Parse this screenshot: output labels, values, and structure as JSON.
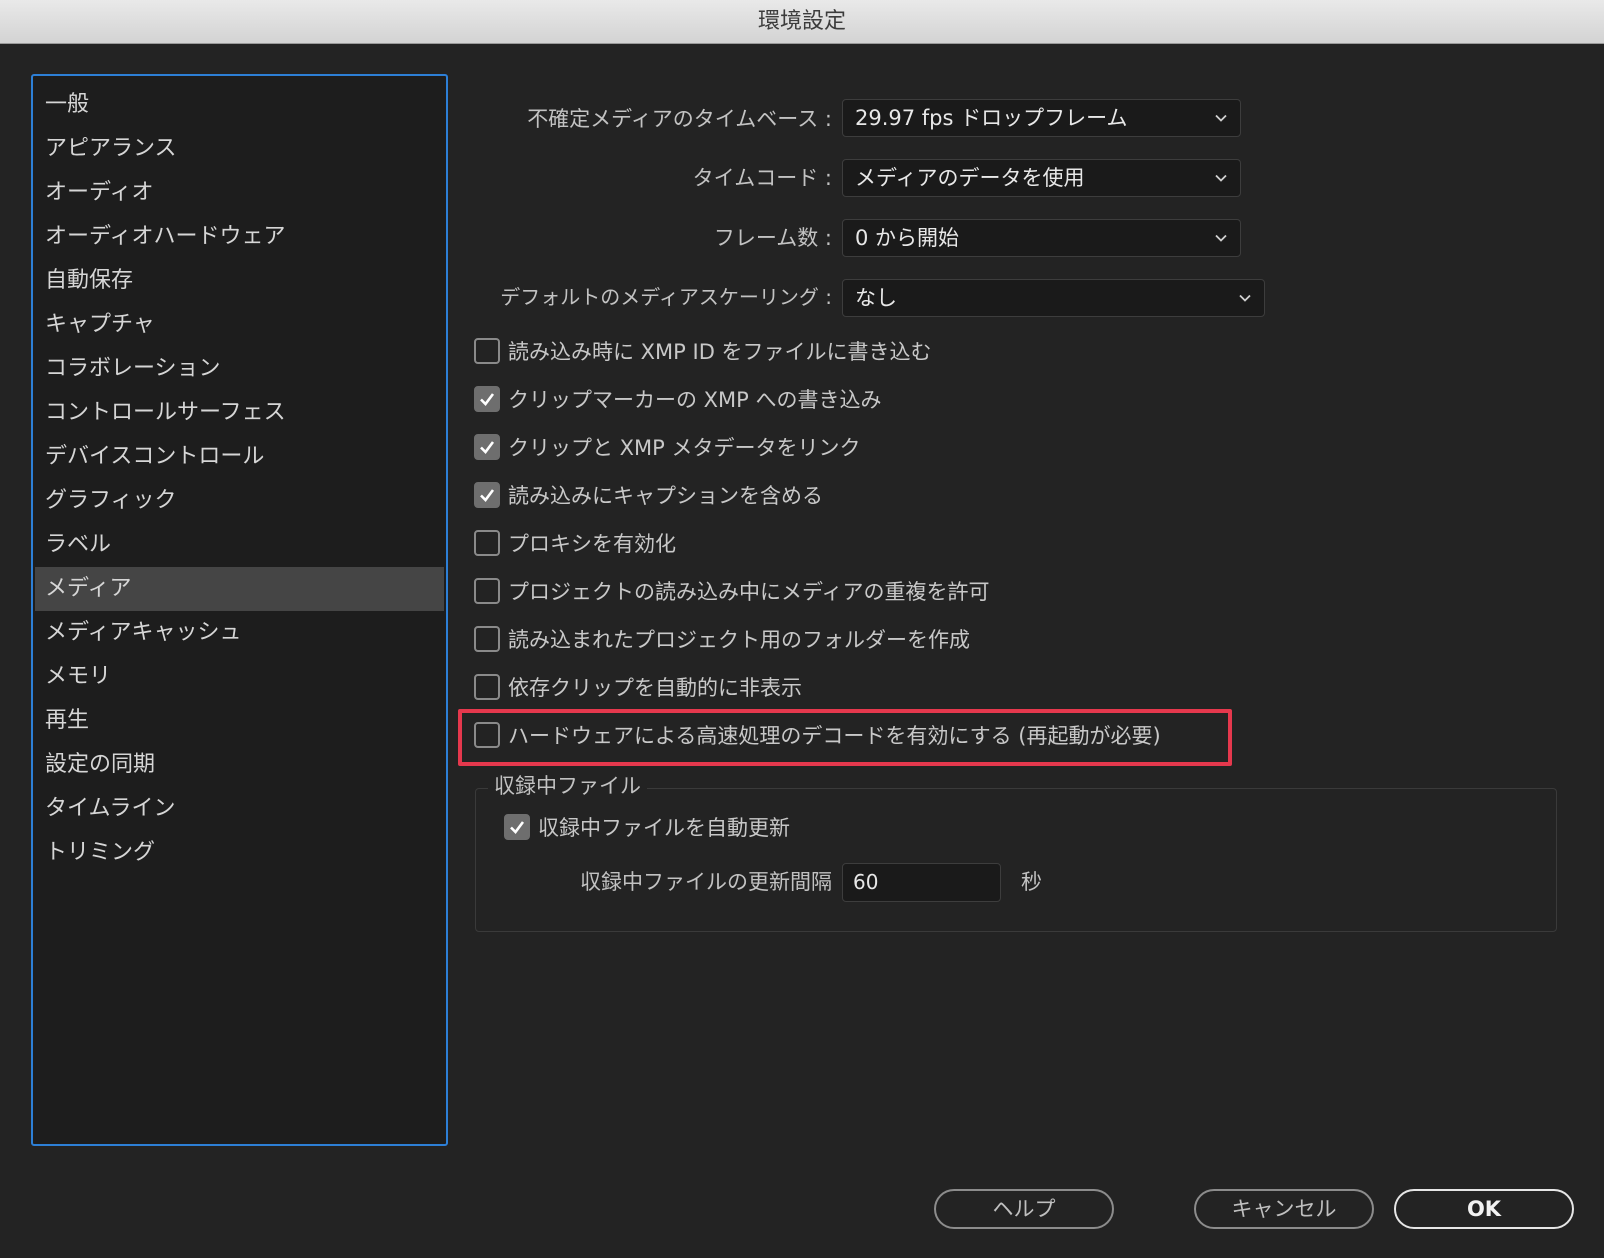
{
  "window": {
    "title": "環境設定"
  },
  "sidebar": {
    "items": [
      {
        "label": "一般"
      },
      {
        "label": "アピアランス"
      },
      {
        "label": "オーディオ"
      },
      {
        "label": "オーディオハードウェア"
      },
      {
        "label": "自動保存"
      },
      {
        "label": "キャプチャ"
      },
      {
        "label": "コラボレーション"
      },
      {
        "label": "コントロールサーフェス"
      },
      {
        "label": "デバイスコントロール"
      },
      {
        "label": "グラフィック"
      },
      {
        "label": "ラベル"
      },
      {
        "label": "メディア",
        "selected": true
      },
      {
        "label": "メディアキャッシュ"
      },
      {
        "label": "メモリ"
      },
      {
        "label": "再生"
      },
      {
        "label": "設定の同期"
      },
      {
        "label": "タイムライン"
      },
      {
        "label": "トリミング"
      }
    ]
  },
  "settings": {
    "timebase": {
      "label": "不確定メディアのタイムベース :",
      "value": "29.97 fps ドロップフレーム"
    },
    "timecode": {
      "label": "タイムコード :",
      "value": "メディアのデータを使用"
    },
    "frame_count": {
      "label": "フレーム数 :",
      "value": "0 から開始"
    },
    "scaling": {
      "label": "デフォルトのメディアスケーリング :",
      "value": "なし"
    }
  },
  "checkboxes": [
    {
      "label": "読み込み時に XMP ID をファイルに書き込む",
      "checked": false
    },
    {
      "label": "クリップマーカーの XMP への書き込み",
      "checked": true
    },
    {
      "label": "クリップと XMP メタデータをリンク",
      "checked": true
    },
    {
      "label": "読み込みにキャプションを含める",
      "checked": true
    },
    {
      "label": "プロキシを有効化",
      "checked": false
    },
    {
      "label": "プロジェクトの読み込み中にメディアの重複を許可",
      "checked": false
    },
    {
      "label": "読み込まれたプロジェクト用のフォルダーを作成",
      "checked": false
    },
    {
      "label": "依存クリップを自動的に非表示",
      "checked": false
    },
    {
      "label": "ハードウェアによる高速処理のデコードを有効にする (再起動が必要)",
      "checked": false
    }
  ],
  "recording_group": {
    "title": "収録中ファイル",
    "auto_refresh": {
      "label": "収録中ファイルを自動更新",
      "checked": true
    },
    "interval": {
      "label": "収録中ファイルの更新間隔",
      "value": "60",
      "unit": "秒"
    }
  },
  "buttons": {
    "help": "ヘルプ",
    "cancel": "キャンセル",
    "ok": "OK"
  },
  "colors": {
    "highlight": "#e5384d",
    "sidebar_border": "#2d7fd6"
  }
}
